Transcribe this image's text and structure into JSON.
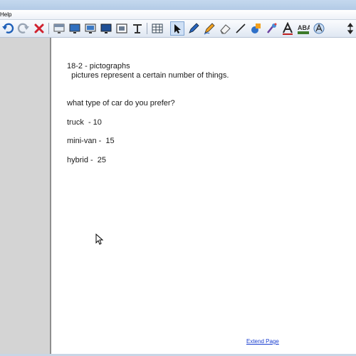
{
  "menubar": {
    "help_label": "Help"
  },
  "toolbar": {
    "tools": [
      {
        "icon": "undo-icon",
        "color": "#1e5fb8"
      },
      {
        "icon": "redo-icon",
        "color": "#9aa6b5"
      },
      {
        "icon": "delete-icon",
        "color": "#d0212e"
      },
      {
        "icon": "screen-shade-icon"
      },
      {
        "icon": "display-icon"
      },
      {
        "icon": "monitor-icon"
      },
      {
        "icon": "presentation-icon"
      },
      {
        "icon": "capture-icon"
      },
      {
        "icon": "text-format-icon"
      },
      {
        "icon": "table-icon"
      },
      {
        "icon": "select-arrow-icon",
        "active": true
      },
      {
        "icon": "pen-icon"
      },
      {
        "icon": "creative-pen-icon"
      },
      {
        "icon": "eraser-icon"
      },
      {
        "icon": "line-icon"
      },
      {
        "icon": "shapes-icon"
      },
      {
        "icon": "magic-pen-icon"
      },
      {
        "icon": "text-icon",
        "color": "#c02020"
      },
      {
        "icon": "font-color-icon"
      },
      {
        "icon": "fill-icon"
      },
      {
        "icon": "move-toolbar-icon"
      }
    ]
  },
  "page": {
    "lines": [
      "18-2 - pictographs",
      "  pictures represent a certain number of things.",
      "what type of car do you prefer?",
      "truck  - 10",
      "mini-van -  15",
      "hybrid -  25"
    ],
    "extend_link": "Extend Page"
  }
}
